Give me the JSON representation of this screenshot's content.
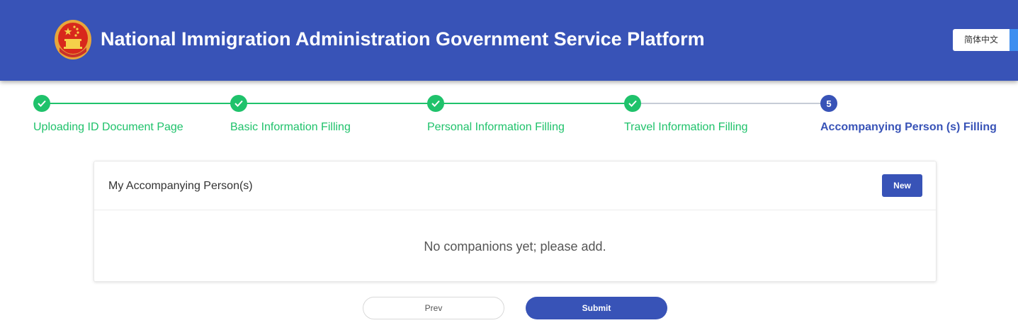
{
  "header": {
    "title": "National Immigration Administration Government Service Platform",
    "language_button": "简体中文"
  },
  "steps": [
    {
      "label": "Uploading ID Document Page",
      "status": "done"
    },
    {
      "label": "Basic Information Filling",
      "status": "done"
    },
    {
      "label": "Personal Information Filling",
      "status": "done"
    },
    {
      "label": "Travel Information Filling",
      "status": "done"
    },
    {
      "label": "Accompanying Person (s) Filling",
      "status": "current",
      "number": "5"
    }
  ],
  "card": {
    "title": "My Accompanying Person(s)",
    "new_button": "New",
    "empty_message": "No companions yet; please add."
  },
  "footer": {
    "prev_button": "Prev",
    "submit_button": "Submit"
  },
  "colors": {
    "brand": "#3853b7",
    "step_done": "#1fc26b",
    "step_todo": "#c6ccd6"
  }
}
